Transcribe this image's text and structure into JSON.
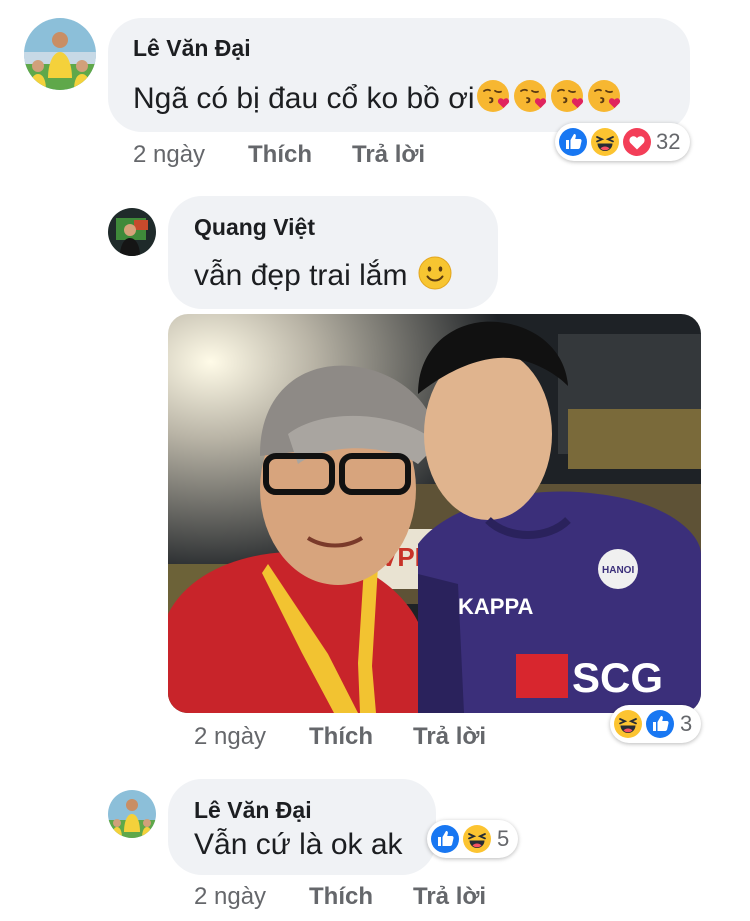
{
  "comments": [
    {
      "author": "Lê Văn Đại",
      "text": "Ngã có bị đau cổ ko bồ ơi",
      "text_emojis": [
        "face-blowing-kiss",
        "face-blowing-kiss",
        "face-blowing-kiss",
        "face-blowing-kiss"
      ],
      "time": "2 ngày",
      "like_label": "Thích",
      "reply_label": "Trả lời",
      "reactions": [
        "like",
        "haha",
        "love"
      ],
      "reaction_count": "32"
    },
    {
      "author": "Quang Việt",
      "text": "vẫn đẹp trai lắm",
      "text_emojis": [
        "slightly-smiling-face"
      ],
      "photo": "selfie-of-two-men-at-football-stadium",
      "time": "2 ngày",
      "like_label": "Thích",
      "reply_label": "Trả lời",
      "reactions": [
        "haha",
        "like"
      ],
      "reaction_count": "3"
    },
    {
      "author": "Lê Văn Đại",
      "text": "Vẫn cứ là ok ak",
      "time": "2 ngày",
      "like_label": "Thích",
      "reply_label": "Trả lời",
      "reactions": [
        "like",
        "haha"
      ],
      "reaction_count": "5"
    }
  ],
  "photo_content": {
    "banner_text": "VPF",
    "jersey_brand": "KAPPA",
    "jersey_sponsor": "SCG",
    "crest_text": "HANOI"
  },
  "colors": {
    "bubble": "#f0f2f5",
    "like_blue": "#1877f2",
    "love_red": "#f33e58",
    "haha_yellow": "#fcc431",
    "meta_gray": "#65676b"
  }
}
